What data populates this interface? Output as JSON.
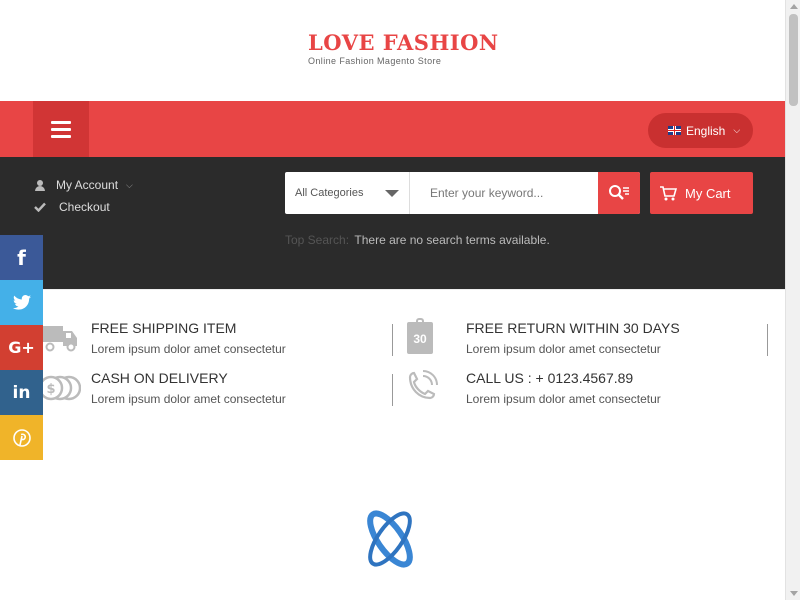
{
  "logo": {
    "title": "LOVE FASHION",
    "subtitle": "Online Fashion Magento Store"
  },
  "header": {
    "language": "English"
  },
  "account": {
    "my_account": "My Account",
    "checkout": "Checkout"
  },
  "search": {
    "category": "All Categories",
    "placeholder": "Enter your keyword...",
    "top_search_label": "Top Search:",
    "top_search_empty": "There are no search terms available."
  },
  "cart": {
    "label": "My Cart"
  },
  "features": [
    {
      "title": "FREE SHIPPING ITEM",
      "desc": "Lorem ipsum dolor amet consectetur"
    },
    {
      "title": "FREE RETURN WITHIN 30 DAYS",
      "desc": "Lorem ipsum dolor amet consectetur",
      "badge": "30"
    },
    {
      "title": "CASH ON DELIVERY",
      "desc": "Lorem ipsum dolor amet consectetur"
    },
    {
      "title": "CALL US : + 0123.4567.89",
      "desc": "Lorem ipsum dolor amet consectetur"
    }
  ],
  "social": [
    "facebook-icon",
    "twitter-icon",
    "google-plus-icon",
    "linkedin-icon",
    "pinterest-icon"
  ],
  "colors": {
    "accent": "#e84545",
    "dark": "#2b2b2b"
  }
}
